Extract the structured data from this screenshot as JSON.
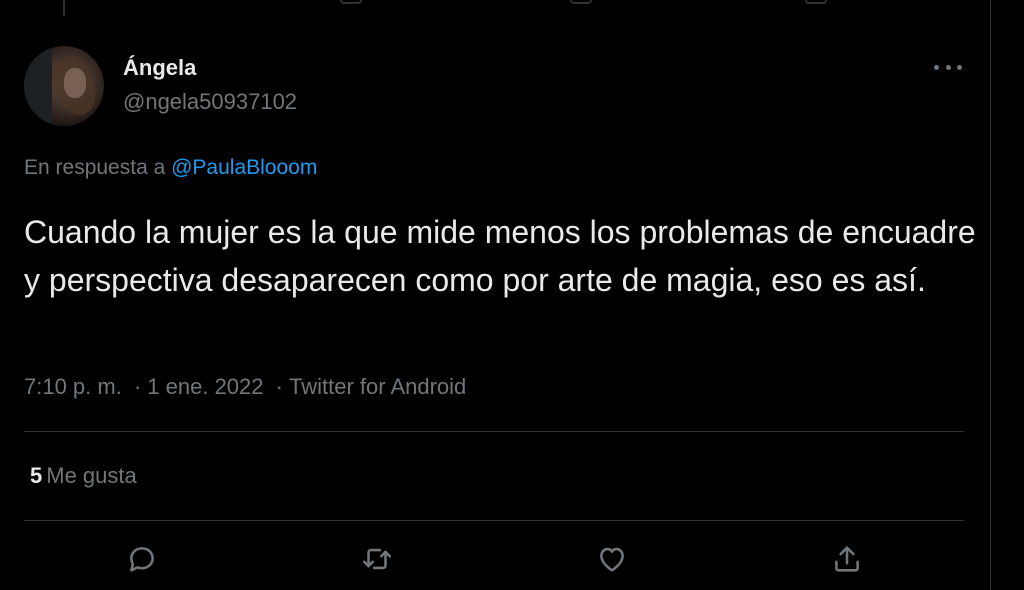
{
  "tweet": {
    "author_name": "Ángela",
    "author_handle": "@ngela50937102",
    "reply_prefix": "En respuesta a",
    "reply_mention": "@PaulaBlooom",
    "text": "Cuando la mujer es la que mide menos los problemas de encuadre y perspectiva desaparecen como por arte de magia, eso es así.",
    "time": "7:10 p. m.",
    "date": "1 ene. 2022",
    "source": "Twitter for Android",
    "separator": "·",
    "likes_count": "5",
    "likes_label": "Me gusta"
  },
  "actions": [
    {
      "name": "reply",
      "icon": "reply-icon"
    },
    {
      "name": "retweet",
      "icon": "retweet-icon"
    },
    {
      "name": "like",
      "icon": "heart-icon"
    },
    {
      "name": "share",
      "icon": "share-icon"
    }
  ],
  "colors": {
    "background": "#000000",
    "text": "#e7e9ea",
    "secondary": "#71767b",
    "accent": "#1d9bf0",
    "border": "#2f3336"
  }
}
